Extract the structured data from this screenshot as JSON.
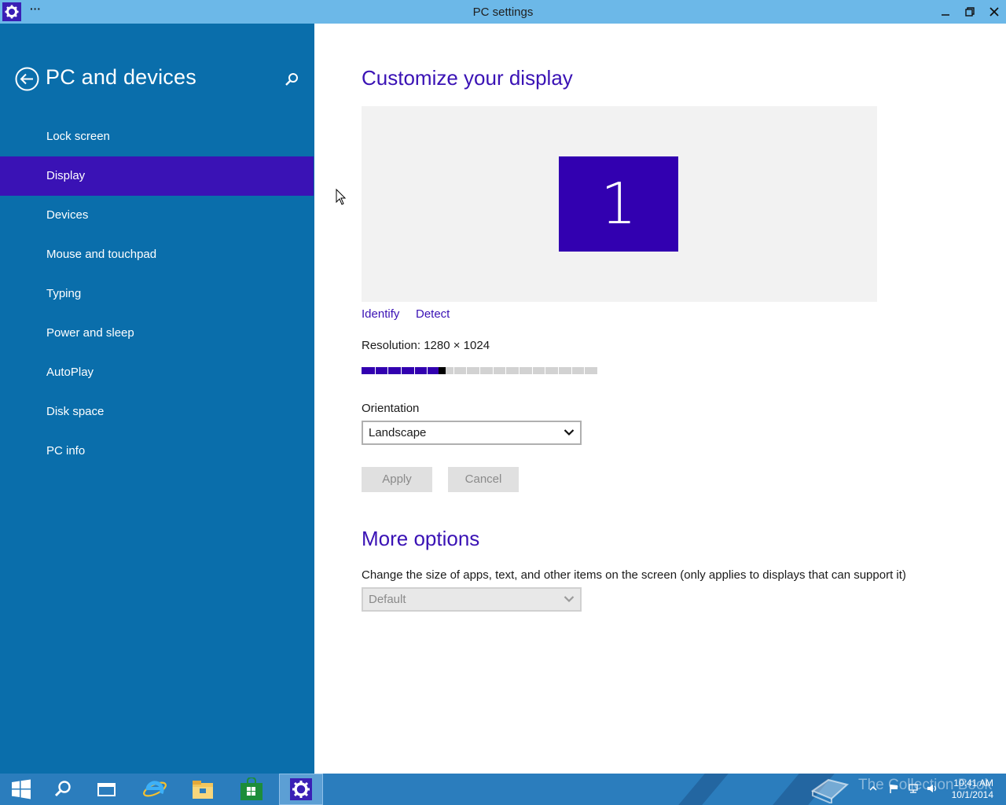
{
  "window": {
    "title": "PC settings",
    "menu_dots": "···"
  },
  "sidebar": {
    "heading": "PC and devices",
    "items": [
      {
        "label": "Lock screen",
        "active": false
      },
      {
        "label": "Display",
        "active": true
      },
      {
        "label": "Devices",
        "active": false
      },
      {
        "label": "Mouse and touchpad",
        "active": false
      },
      {
        "label": "Typing",
        "active": false
      },
      {
        "label": "Power and sleep",
        "active": false
      },
      {
        "label": "AutoPlay",
        "active": false
      },
      {
        "label": "Disk space",
        "active": false
      },
      {
        "label": "PC info",
        "active": false
      }
    ]
  },
  "main": {
    "title": "Customize your display",
    "monitor_number": "1",
    "identify_label": "Identify",
    "detect_label": "Detect",
    "resolution_label": "Resolution: 1280 × 1024",
    "resolution_slider": {
      "steps": 9,
      "position": 3
    },
    "orientation_label": "Orientation",
    "orientation_value": "Landscape",
    "apply_label": "Apply",
    "cancel_label": "Cancel",
    "more_options_title": "More options",
    "scaling_label": "Change the size of apps, text, and other items on the screen (only applies to displays that can support it)",
    "scaling_value": "Default"
  },
  "taskbar": {
    "items": [
      "start-icon",
      "search-icon",
      "task-view-icon",
      "internet-explorer-icon",
      "file-explorer-icon",
      "store-icon",
      "settings-icon"
    ],
    "active_item": "settings-icon",
    "watermark": "The Collection Book",
    "time": "10:41 AM",
    "date": "10/1/2014"
  },
  "colors": {
    "titlebar": "#6cb8e8",
    "sidebar": "#0a6eab",
    "accent": "#3a12b5",
    "taskbar": "#2b7dbd"
  }
}
